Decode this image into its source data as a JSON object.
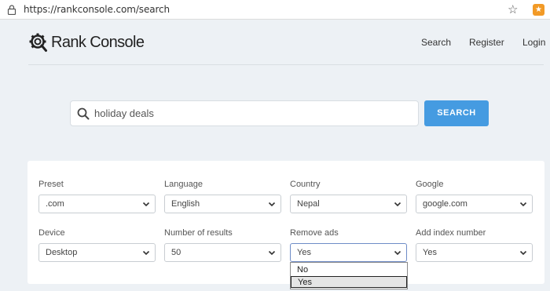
{
  "browser": {
    "url": "https://rankconsole.com/search",
    "extension_badge": "★"
  },
  "header": {
    "brand": "Rank Console",
    "nav": {
      "search": "Search",
      "register": "Register",
      "login": "Login"
    }
  },
  "search": {
    "query": "holiday deals",
    "button_label": "SEARCH"
  },
  "options": {
    "preset": {
      "label": "Preset",
      "value": ".com"
    },
    "language": {
      "label": "Language",
      "value": "English"
    },
    "country": {
      "label": "Country",
      "value": "Nepal"
    },
    "google": {
      "label": "Google",
      "value": "google.com"
    },
    "device": {
      "label": "Device",
      "value": "Desktop"
    },
    "results": {
      "label": "Number of results",
      "value": "50"
    },
    "remove_ads": {
      "label": "Remove ads",
      "value": "Yes",
      "options": [
        "No",
        "Yes"
      ]
    },
    "add_index": {
      "label": "Add index number",
      "value": "Yes"
    }
  },
  "colors": {
    "accent": "#459be1",
    "background": "#edf1f5",
    "extension": "#f29a26"
  }
}
